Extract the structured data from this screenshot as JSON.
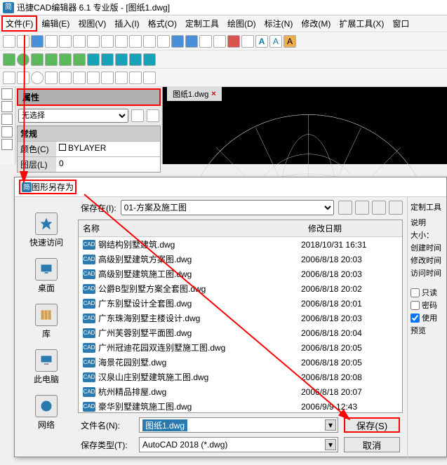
{
  "app": {
    "title": "迅捷CAD编辑器 6.1 专业版 - [图纸1.dwg]",
    "icon_text": "简"
  },
  "menu": [
    "文件(F)",
    "编辑(E)",
    "视图(V)",
    "插入(I)",
    "格式(O)",
    "定制工具",
    "绘图(D)",
    "标注(N)",
    "修改(M)",
    "扩展工具(X)",
    "窗口"
  ],
  "props": {
    "panel_title": "属性",
    "noselect": "无选择",
    "section": "常规",
    "color_label": "颜色(C)",
    "color_value": "BYLAYER",
    "layer_label": "图层(L)",
    "layer_value": "0"
  },
  "canvas_tab": "图纸1.dwg",
  "dialog": {
    "title": "图形另存为",
    "save_in_label": "保存在(I):",
    "save_in_value": "01-方案及施工图",
    "columns": {
      "name": "名称",
      "date": "修改日期"
    },
    "files": [
      {
        "n": "钢结构别墅建筑.dwg",
        "d": "2018/10/31 16:31"
      },
      {
        "n": "高级别墅建筑方案图.dwg",
        "d": "2006/8/18 20:03"
      },
      {
        "n": "高级别墅建筑施工图.dwg",
        "d": "2006/8/18 20:03"
      },
      {
        "n": "公爵B型别墅方案全套图.dwg",
        "d": "2006/8/18 20:02"
      },
      {
        "n": "广东别墅设计全套图.dwg",
        "d": "2006/8/18 20:01"
      },
      {
        "n": "广东珠海别墅主楼设计.dwg",
        "d": "2006/8/18 20:03"
      },
      {
        "n": "广州芙蓉别墅平面图.dwg",
        "d": "2006/8/18 20:04"
      },
      {
        "n": "广州冠迪花园双连别墅施工图.dwg",
        "d": "2006/8/18 20:05"
      },
      {
        "n": "海景花园别墅.dwg",
        "d": "2006/8/18 20:05"
      },
      {
        "n": "汉泉山庄别墅建筑施工图.dwg",
        "d": "2006/8/18 20:08"
      },
      {
        "n": "杭州精品排屋.dwg",
        "d": "2006/8/18 20:07"
      },
      {
        "n": "豪华别墅建筑施工图.dwg",
        "d": "2006/9/9 12:43"
      }
    ],
    "filename_label": "文件名(N):",
    "filename_value": "图纸1.dwg",
    "filetype_label": "保存类型(T):",
    "filetype_value": "AutoCAD 2018 (*.dwg)",
    "save_btn": "保存(S)",
    "cancel_btn": "取消",
    "sidebar": [
      {
        "k": "quick",
        "label": "快速访问"
      },
      {
        "k": "desktop",
        "label": "桌面"
      },
      {
        "k": "lib",
        "label": "库"
      },
      {
        "k": "thispc",
        "label": "此电脑"
      },
      {
        "k": "network",
        "label": "网络"
      }
    ],
    "right": {
      "header": "定制工具",
      "desc": "说明",
      "size": "大小：",
      "ctime": "创建时间",
      "mtime": "修改时间",
      "atime": "访问时间",
      "readonly": "只读",
      "password": "密码",
      "use": "使用",
      "preview": "预览"
    }
  }
}
